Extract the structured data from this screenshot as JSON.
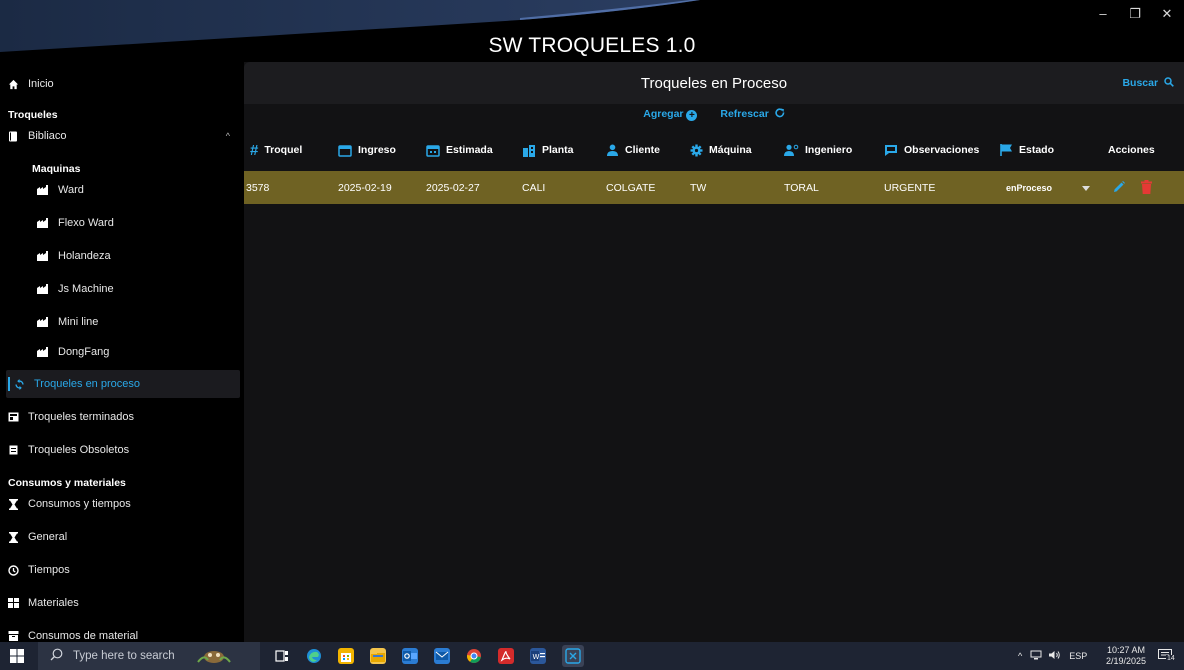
{
  "window": {
    "title": "SW TROQUELES 1.0",
    "controls": {
      "minimize": "–",
      "maximize": "❐",
      "close": "✕"
    }
  },
  "sidebar": {
    "inicio": "Inicio",
    "section_troqueles": "Troqueles",
    "bibliaco": "Bibliaco",
    "maquinas_heading": "Maquinas",
    "machines": [
      "Ward",
      "Flexo Ward",
      "Holandeza",
      "Js Machine",
      "Mini line",
      "DongFang"
    ],
    "troqueles_en_proceso": "Troqueles en proceso",
    "troqueles_terminados": "Troqueles terminados",
    "troqueles_obsoletos": "Troqueles Obsoletos",
    "section_consumos": "Consumos  y materiales",
    "consumos_items": [
      "Consumos y tiempos",
      "General",
      "Tiempos",
      "Materiales",
      "Consumos de material"
    ]
  },
  "main": {
    "title": "Troqueles en Proceso",
    "buscar": "Buscar",
    "agregar": "Agregar",
    "refrescar": "Refrescar",
    "columns": [
      "Troquel",
      "Ingreso",
      "Estimada",
      "Planta",
      "Cliente",
      "Máquina",
      "Ingeniero",
      "Observaciones",
      "Estado",
      "Acciones"
    ],
    "rows": [
      {
        "troquel": "3578",
        "ingreso": "2025-02-19",
        "estimada": "2025-02-27",
        "planta": "CALI",
        "cliente": "COLGATE",
        "maquina": "TW",
        "ingeniero": "TORAL",
        "observaciones": "URGENTE",
        "estado": "enProceso"
      }
    ],
    "row_color": "#6f6223",
    "accent": "#2aa8e8",
    "delete_color": "#e53935"
  },
  "taskbar": {
    "search_placeholder": "Type here to search",
    "language": "ESP",
    "time": "10:27 AM",
    "date": "2/19/2025",
    "notifications": "14"
  }
}
